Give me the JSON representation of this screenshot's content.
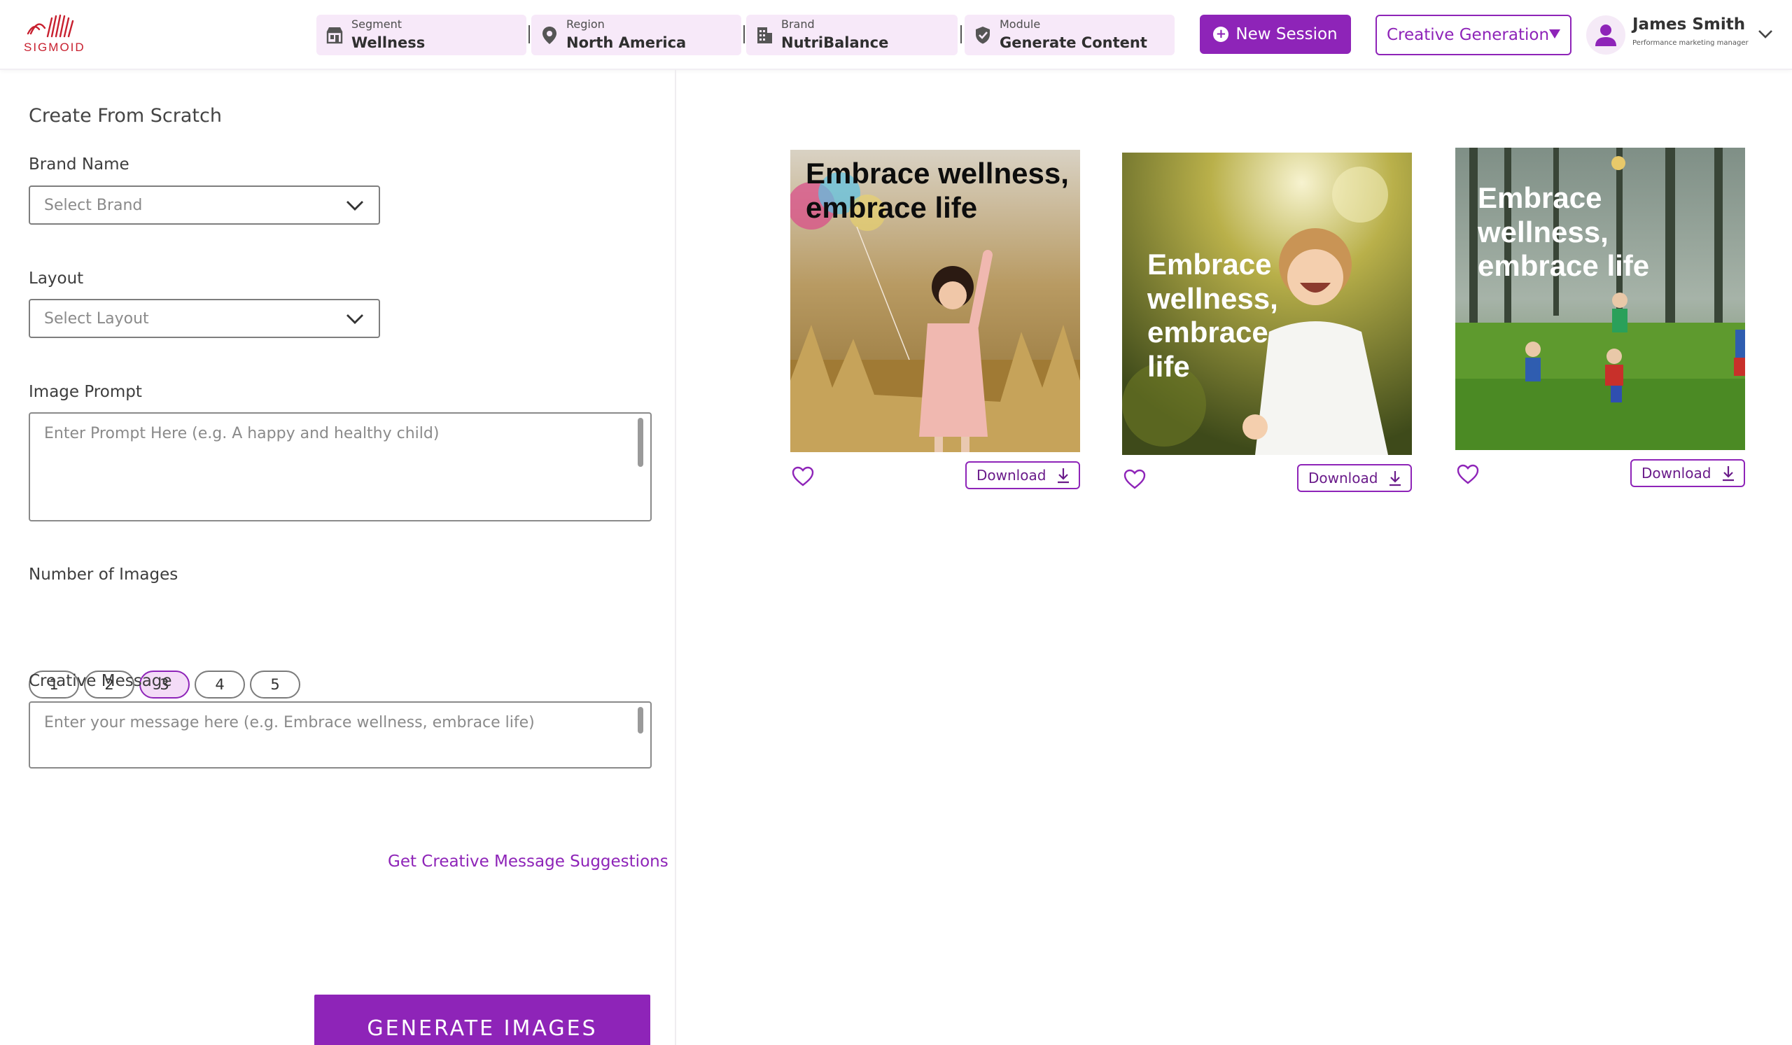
{
  "header": {
    "logo_text": "SIGMOID",
    "context": [
      {
        "label": "Segment",
        "value": "Wellness",
        "icon": "store-icon"
      },
      {
        "label": "Region",
        "value": "North America",
        "icon": "location-pin-icon"
      },
      {
        "label": "Brand",
        "value": "NutriBalance",
        "icon": "building-icon"
      },
      {
        "label": "Module",
        "value": "Generate Content",
        "icon": "shield-check-icon"
      }
    ],
    "new_session_label": "New Session",
    "mode_label": "Creative Generation",
    "user": {
      "name": "James Smith",
      "role": "Performance marketing manager"
    }
  },
  "form": {
    "title": "Create From Scratch",
    "brand_label": "Brand Name",
    "brand_placeholder": "Select Brand",
    "layout_label": "Layout",
    "layout_placeholder": "Select Layout",
    "prompt_label": "Image Prompt",
    "prompt_placeholder": "Enter Prompt Here (e.g. A happy and healthy child)",
    "count_label": "Number of Images",
    "counts": [
      "1",
      "2",
      "3",
      "4",
      "5"
    ],
    "selected_count": "3",
    "message_label": "Creative Message",
    "message_placeholder": "Enter your message here (e.g. Embrace wellness, embrace life)",
    "suggest_link": "Get Creative Message Suggestions",
    "generate_label": "GENERATE IMAGES"
  },
  "results": [
    {
      "message": "Embrace wellness, embrace life",
      "download_label": "Download",
      "scene": "girl-with-balloons"
    },
    {
      "message": "Embrace wellness, embrace life",
      "download_label": "Download",
      "scene": "smiling-toddler"
    },
    {
      "message": "Embrace wellness, embrace life",
      "download_label": "Download",
      "scene": "kids-playing-in-forest"
    }
  ],
  "colors": {
    "accent": "#8e24b8",
    "context_bg": "#f7e9f9",
    "logo_red": "#c8202f"
  }
}
